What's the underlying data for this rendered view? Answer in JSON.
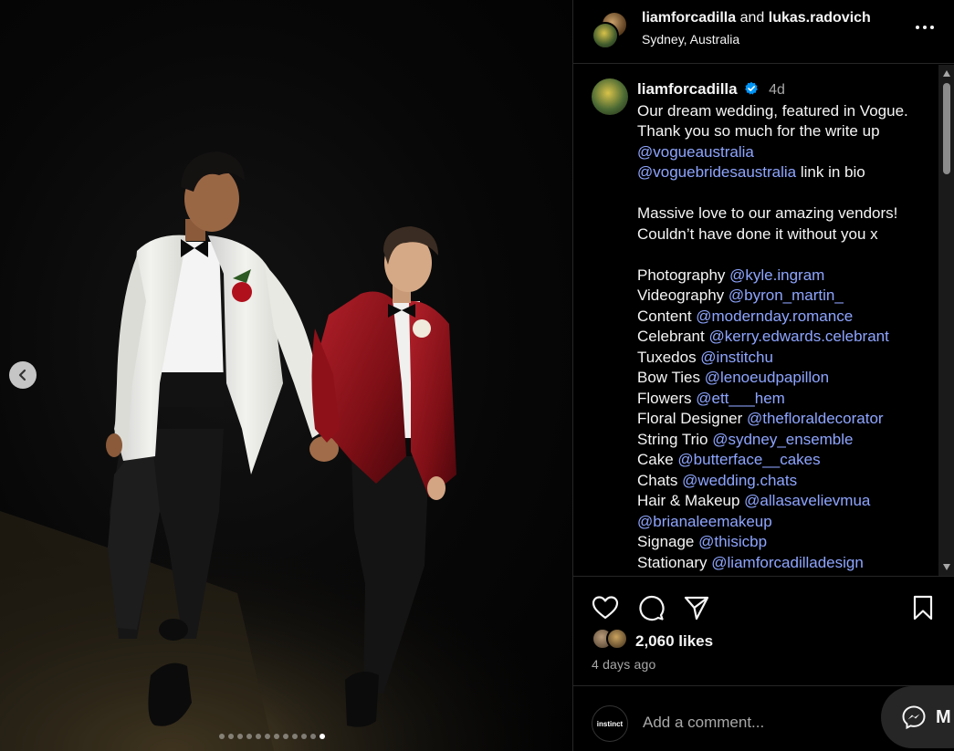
{
  "header": {
    "user1": "liamforcadilla",
    "conjunction": "and",
    "user2": "lukas.radovich",
    "location": "Sydney, Australia"
  },
  "caption": {
    "username": "liamforcadilla",
    "time": "4d",
    "lines": [
      [
        {
          "t": "Our dream wedding, featured in Vogue."
        }
      ],
      [
        {
          "t": "Thank you so much for the write up"
        }
      ],
      [
        {
          "m": "@vogueaustralia"
        }
      ],
      [
        {
          "m": "@voguebridesaustralia"
        },
        {
          "t": " link in bio"
        }
      ],
      [],
      [
        {
          "t": "Massive love to our amazing vendors!"
        }
      ],
      [
        {
          "t": "Couldn’t have done it without you x"
        }
      ],
      [],
      [
        {
          "t": "Photography "
        },
        {
          "m": "@kyle.ingram"
        }
      ],
      [
        {
          "t": "Videography "
        },
        {
          "m": "@byron_martin_"
        }
      ],
      [
        {
          "t": "Content "
        },
        {
          "m": "@modernday.romance"
        }
      ],
      [
        {
          "t": "Celebrant "
        },
        {
          "m": "@kerry.edwards.celebrant"
        }
      ],
      [
        {
          "t": "Tuxedos "
        },
        {
          "m": "@institchu"
        }
      ],
      [
        {
          "t": "Bow Ties "
        },
        {
          "m": "@lenoeudpapillon"
        }
      ],
      [
        {
          "t": "Flowers "
        },
        {
          "m": "@ett___hem"
        }
      ],
      [
        {
          "t": "Floral Designer "
        },
        {
          "m": "@thefloraldecorator"
        }
      ],
      [
        {
          "t": "String Trio "
        },
        {
          "m": "@sydney_ensemble"
        }
      ],
      [
        {
          "t": "Cake "
        },
        {
          "m": "@butterface__cakes"
        }
      ],
      [
        {
          "t": "Chats "
        },
        {
          "m": "@wedding.chats"
        }
      ],
      [
        {
          "t": "Hair & Makeup "
        },
        {
          "m": "@allasavelievmua"
        }
      ],
      [
        {
          "m": "@brianaleemakeup"
        }
      ],
      [
        {
          "t": "Signage "
        },
        {
          "m": "@thisicbp"
        }
      ],
      [
        {
          "t": "Stationary "
        },
        {
          "m": "@liamforcadilladesign"
        }
      ]
    ]
  },
  "engagement": {
    "likes": "2,060 likes",
    "ago": "4 days ago"
  },
  "comment": {
    "placeholder": "Add a comment...",
    "avatar_text": "instinct"
  },
  "messages": {
    "label": "M"
  },
  "carousel": {
    "count": 12,
    "active": 11
  },
  "colors": {
    "mention": "#8ea5ff",
    "verified": "#0095f6",
    "background": "#000000"
  },
  "icons": [
    "chevron-left-icon",
    "more-icon",
    "verified-icon",
    "heart-icon",
    "comment-icon",
    "share-icon",
    "bookmark-icon",
    "messenger-icon"
  ]
}
